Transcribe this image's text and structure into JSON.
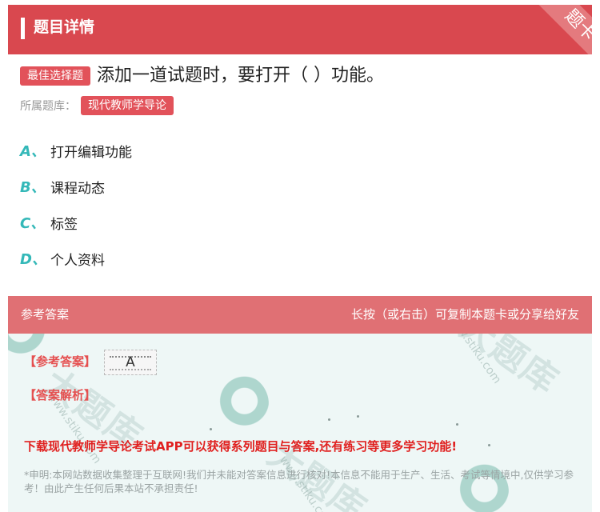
{
  "header": {
    "title": "题目详情",
    "corner_label": "题卡"
  },
  "question": {
    "type_tag": "最佳选择题",
    "text": "添加一道试题时，要打开（ ）功能。",
    "bank_label": "所属题库：",
    "bank_name": "现代教师学导论"
  },
  "options": [
    {
      "letter": "A、",
      "text": "打开编辑功能"
    },
    {
      "letter": "B、",
      "text": "课程动态"
    },
    {
      "letter": "C、",
      "text": "标签"
    },
    {
      "letter": "D、",
      "text": "个人资料"
    }
  ],
  "answer_section": {
    "header_left": "参考答案",
    "header_right": "长按（或右击）可复制本题卡或分享给好友",
    "ref_answer_label": "【参考答案】",
    "ref_answer_value": "A",
    "analysis_label": "【答案解析】",
    "promo": "下载现代教师学导论考试APP可以获得系列题目与答案,还有练习等更多学习功能!",
    "disclaimer": "*申明:本网站数据收集整理于互联网!我们并未能对答案信息进行核对!本信息不能用于生产、生活、考试等情境中,仅供学习参考！由此产生任何后果本站不承担责任!"
  },
  "watermark": {
    "text": "大题库",
    "url": "www.stiku.com"
  },
  "colors": {
    "header_red": "#d9484f",
    "tag_red": "#e2525a",
    "option_teal": "#34b8b8",
    "answer_header": "#e07074",
    "answer_body": "#eef7f6",
    "promo_red": "#e0201f"
  }
}
